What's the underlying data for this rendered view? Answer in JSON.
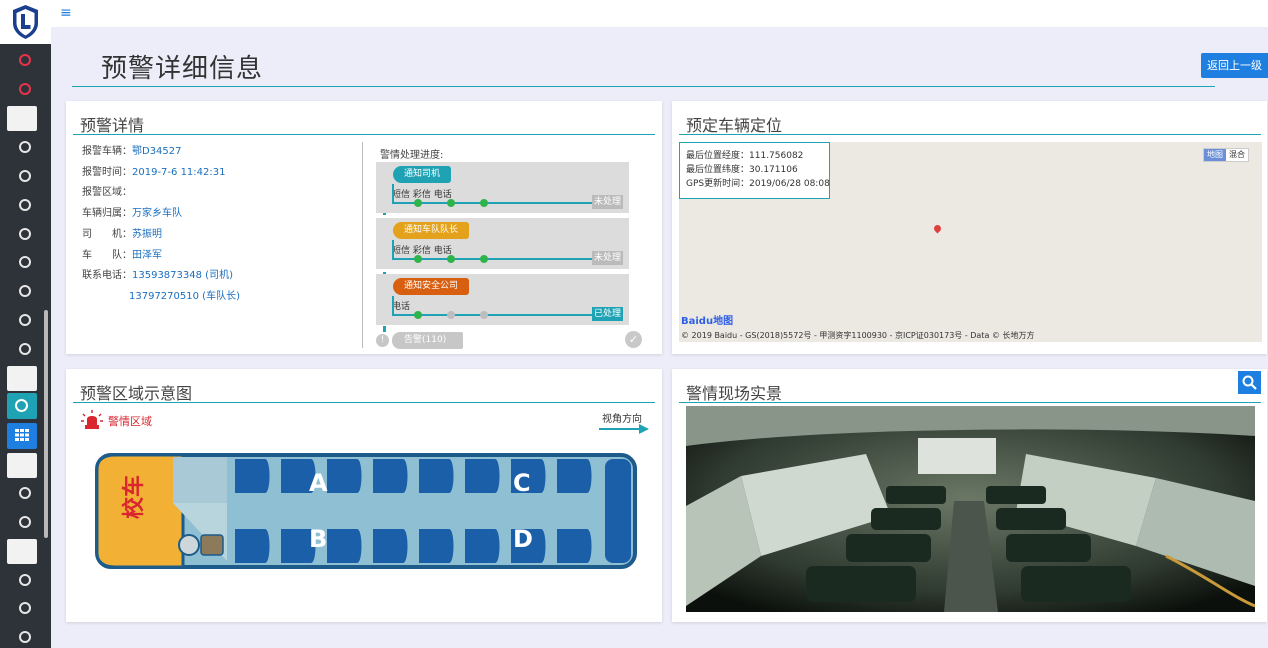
{
  "sidebar": {
    "active_item": "alarm-detail"
  },
  "topbar": {
    "menu_icon": "hamburger-icon"
  },
  "page": {
    "title": "预警详细信息",
    "back_button": "返回上一级"
  },
  "detail": {
    "panel_title": "预警详情",
    "fields": [
      {
        "label": "报警车辆：",
        "value": "鄂D34527"
      },
      {
        "label": "报警时间：",
        "value": "2019-7-6 11:42:31"
      },
      {
        "label": "报警区域：",
        "value": ""
      },
      {
        "label": "车辆归属：",
        "value": "万家乡车队"
      },
      {
        "label": "司　　机：",
        "value": "苏振明"
      },
      {
        "label": "车　　队：",
        "value": "田泽军"
      },
      {
        "label": "联系电话：",
        "value": "13593873348 (司机)"
      },
      {
        "label": "",
        "value": "13797270510 (车队长)"
      }
    ],
    "progress_title": "警情处理进度:",
    "stages": [
      {
        "badge": "通知司机",
        "methods": "短信  彩信  电话",
        "status": "未处理",
        "color": "#1fa3b4",
        "line_color": "#1fa3b4"
      },
      {
        "badge": "通知车队队长",
        "methods": "短信  彩信  电话",
        "status": "未处理",
        "color": "#e3a11c",
        "line_color": "#1fa3b4"
      },
      {
        "badge": "通知安全公司",
        "methods": "电话",
        "status": "已处理",
        "color": "#d95f10",
        "line_color": "#1fa3b4"
      }
    ],
    "alarm_pill": "告警(110)"
  },
  "location": {
    "panel_title": "预定车辆定位",
    "info": [
      {
        "label": "最后位置经度：",
        "value": "111.756082"
      },
      {
        "label": "最后位置纬度：",
        "value": "30.171106"
      },
      {
        "label": "GPS更新时间：",
        "value": "2019/06/28 08:08"
      }
    ],
    "map_type_options": [
      "地图",
      "混合"
    ],
    "map_type_selected": "地图",
    "baidu_logo": "Baidu地图",
    "copyright": "© 2019 Baidu - GS(2018)5572号 - 甲测资字1100930 - 京ICP证030173号 - Data © 长地万方"
  },
  "zone": {
    "panel_title": "预警区域示意图",
    "legend_label": "警情区域",
    "view_direction": "视角方向",
    "bus_sign": "校车",
    "zones": [
      "A",
      "B",
      "C",
      "D"
    ]
  },
  "scene": {
    "panel_title": "警情现场实景"
  },
  "colors": {
    "accent": "#1fa3b4",
    "primary": "#1e7fe0",
    "alarm": "#d9262f",
    "sidebar": "#2e3339"
  }
}
